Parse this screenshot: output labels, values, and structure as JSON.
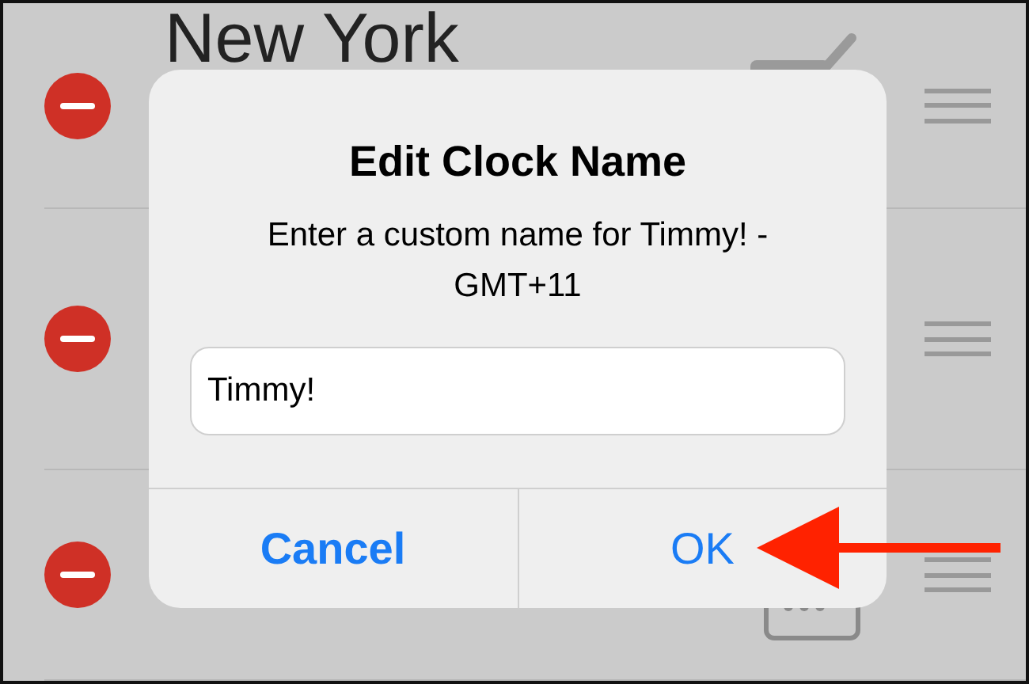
{
  "clocks": [
    {
      "name": "New York",
      "kind": "edit"
    },
    {
      "kind": "blank"
    },
    {
      "kind": "keyboard"
    }
  ],
  "dialog": {
    "title": "Edit Clock Name",
    "message": "Enter a custom name for  Timmy! - GMT+11",
    "field_value": "Timmy!",
    "buttons": [
      {
        "label": "Cancel",
        "kind": "cancel"
      },
      {
        "label": "OK",
        "kind": "default"
      }
    ]
  },
  "annotation": {
    "kind": "arrow"
  }
}
